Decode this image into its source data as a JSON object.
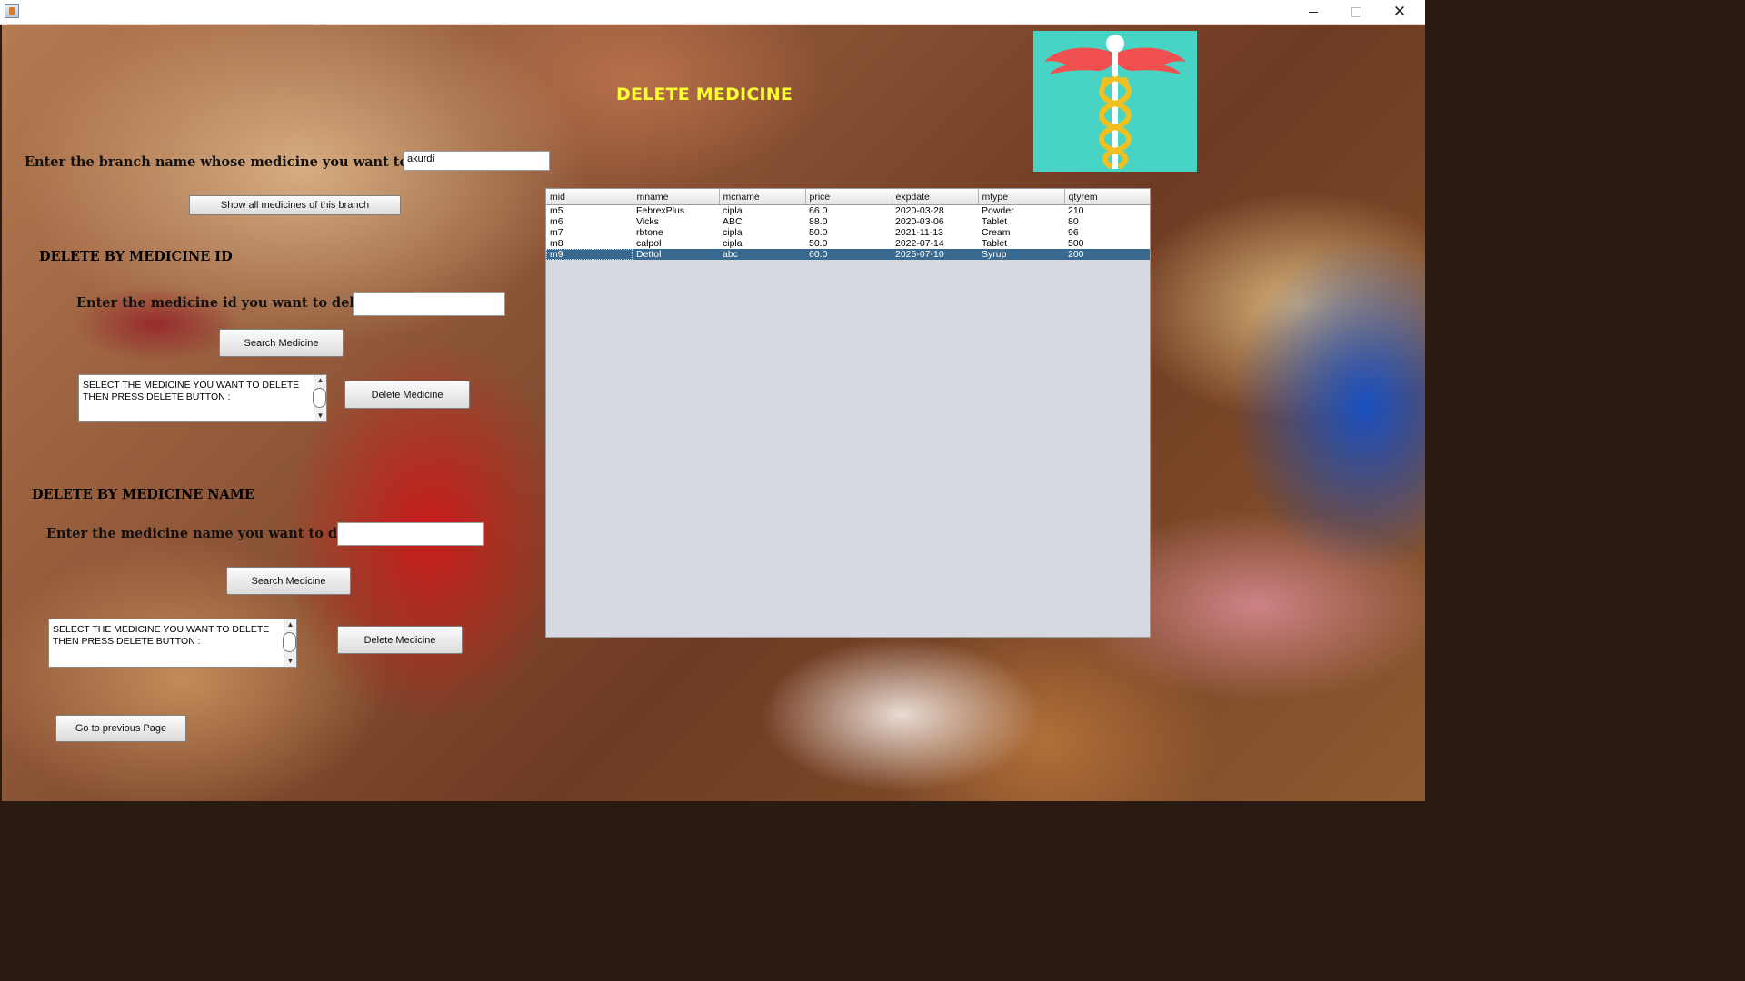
{
  "window": {
    "minimize": "—",
    "maximize": "□",
    "close": "✕"
  },
  "page_title": "DELETE MEDICINE",
  "branch": {
    "label": "Enter the branch name whose medicine you want to delete :",
    "value": "akurdi",
    "show_button": "Show all medicines of this branch"
  },
  "by_id": {
    "heading": "DELETE BY MEDICINE ID",
    "label": "Enter the medicine id you want to delete :",
    "value": "",
    "search_button": "Search Medicine",
    "instructions": "SELECT THE MEDICINE YOU WANT TO DELETE\nTHEN PRESS DELETE BUTTON :",
    "delete_button": "Delete Medicine"
  },
  "by_name": {
    "heading": "DELETE BY MEDICINE NAME",
    "label": "Enter the medicine name you want to delete :",
    "value": "",
    "search_button": "Search Medicine",
    "instructions": "SELECT THE MEDICINE YOU WANT TO DELETE\nTHEN PRESS DELETE BUTTON :",
    "delete_button": "Delete Medicine"
  },
  "back_button": "Go to previous Page",
  "table": {
    "columns": [
      "mid",
      "mname",
      "mcname",
      "price",
      "expdate",
      "mtype",
      "qtyrem"
    ],
    "rows": [
      [
        "m5",
        "FebrexPlus",
        "cipla",
        "66.0",
        "2020-03-28",
        "Powder",
        "210"
      ],
      [
        "m6",
        "Vicks",
        "ABC",
        "88.0",
        "2020-03-06",
        "Tablet",
        "80"
      ],
      [
        "m7",
        "rbtone",
        "cipla",
        "50.0",
        "2021-11-13",
        "Cream",
        "96"
      ],
      [
        "m8",
        "calpol",
        "cipla",
        "50.0",
        "2022-07-14",
        "Tablet",
        "500"
      ],
      [
        "m9",
        "Dettol",
        "abc",
        "60.0",
        "2025-07-10",
        "Syrup",
        "200"
      ]
    ],
    "selected_row": 4
  },
  "colors": {
    "title": "#ffff33",
    "selection": "#39698f",
    "logo_bg": "#48d4c4",
    "logo_wings": "#f05050",
    "logo_snake": "#f0c020"
  }
}
